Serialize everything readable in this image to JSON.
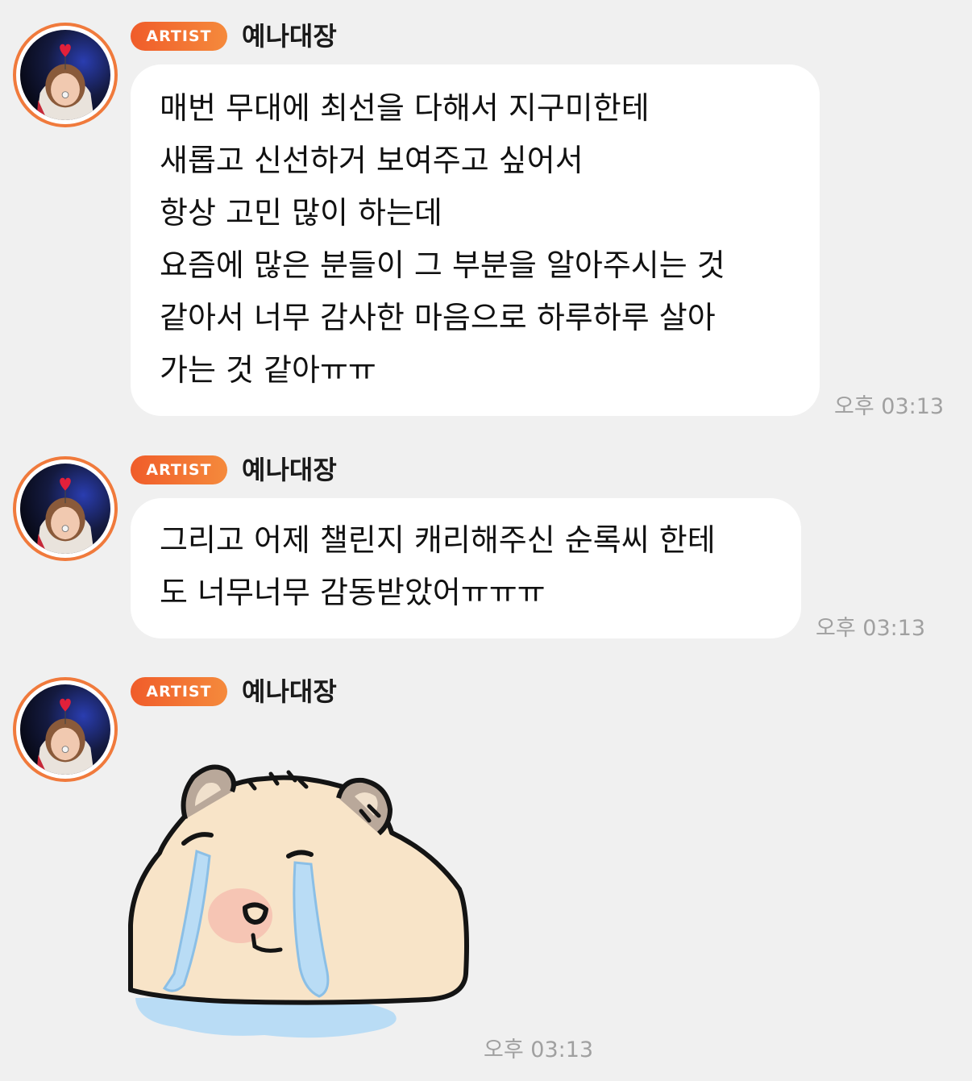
{
  "messages": [
    {
      "badge": "ARTIST",
      "sender": "예나대장",
      "lines": [
        "매번 무대에 최선을 다해서 지구미한테",
        "새롭고 신선하거 보여주고 싶어서",
        "항상 고민 많이 하는데",
        "요즘에 많은 분들이 그 부분을 알아주시는 것",
        "같아서 너무 감사한 마음으로 하루하루 살아",
        "가는 것 같아ㅠㅠ"
      ],
      "time": "오후 03:13"
    },
    {
      "badge": "ARTIST",
      "sender": "예나대장",
      "lines": [
        "그리고 어제 챌린지 캐리해주신 순록씨 한테",
        "도 너무너무 감동받았어ㅠㅠㅠ"
      ],
      "time": "오후 03:13"
    },
    {
      "badge": "ARTIST",
      "sender": "예나대장",
      "sticker": "crying-capybara-sticker",
      "time": "오후 03:13"
    }
  ],
  "colors": {
    "background": "#f0f0f0",
    "bubble": "#ffffff",
    "accent": "#f07a3c",
    "timestamp": "#a0a0a0"
  }
}
